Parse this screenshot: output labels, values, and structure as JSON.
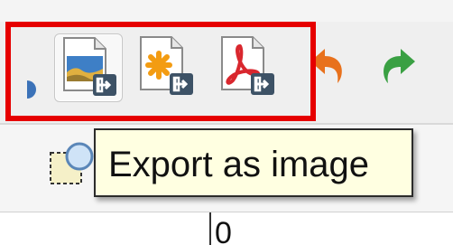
{
  "toolbar": {
    "buttons": [
      {
        "icon": "export-image-icon"
      },
      {
        "icon": "export-svg-icon"
      },
      {
        "icon": "export-pdf-icon"
      },
      {
        "icon": "undo-icon"
      },
      {
        "icon": "redo-icon"
      }
    ]
  },
  "tooltip": {
    "text": "Export as image"
  },
  "ruler": {
    "label": "0"
  },
  "colors": {
    "highlight": "#e60000",
    "tooltip_background": "#ffffe1",
    "undo_orange": "#e8711c",
    "redo_green": "#3aa043",
    "pdf_red": "#d9272e",
    "svg_orange": "#f39c12",
    "export_badge": "#3d5266"
  }
}
